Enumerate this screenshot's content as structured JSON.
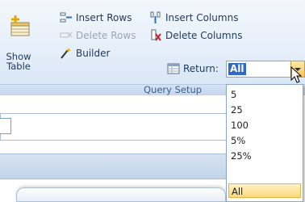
{
  "ribbon": {
    "group_caption": "Query Setup",
    "show_table_label_line1": "Show",
    "show_table_label_line2": "Table",
    "insert_rows": "Insert Rows",
    "delete_rows": "Delete Rows",
    "builder": "Builder",
    "insert_columns": "Insert Columns",
    "delete_columns": "Delete Columns",
    "return_label": "Return:",
    "return_value": "All"
  },
  "dropdown": {
    "options": [
      "5",
      "25",
      "100",
      "5%",
      "25%",
      "All"
    ],
    "selected": "All"
  },
  "colors": {
    "ribbon_text": "#1e395b",
    "selection_fill": "#3169c6",
    "hover_highlight": "#fbd97a",
    "delete_icon_red": "#c0262d"
  }
}
